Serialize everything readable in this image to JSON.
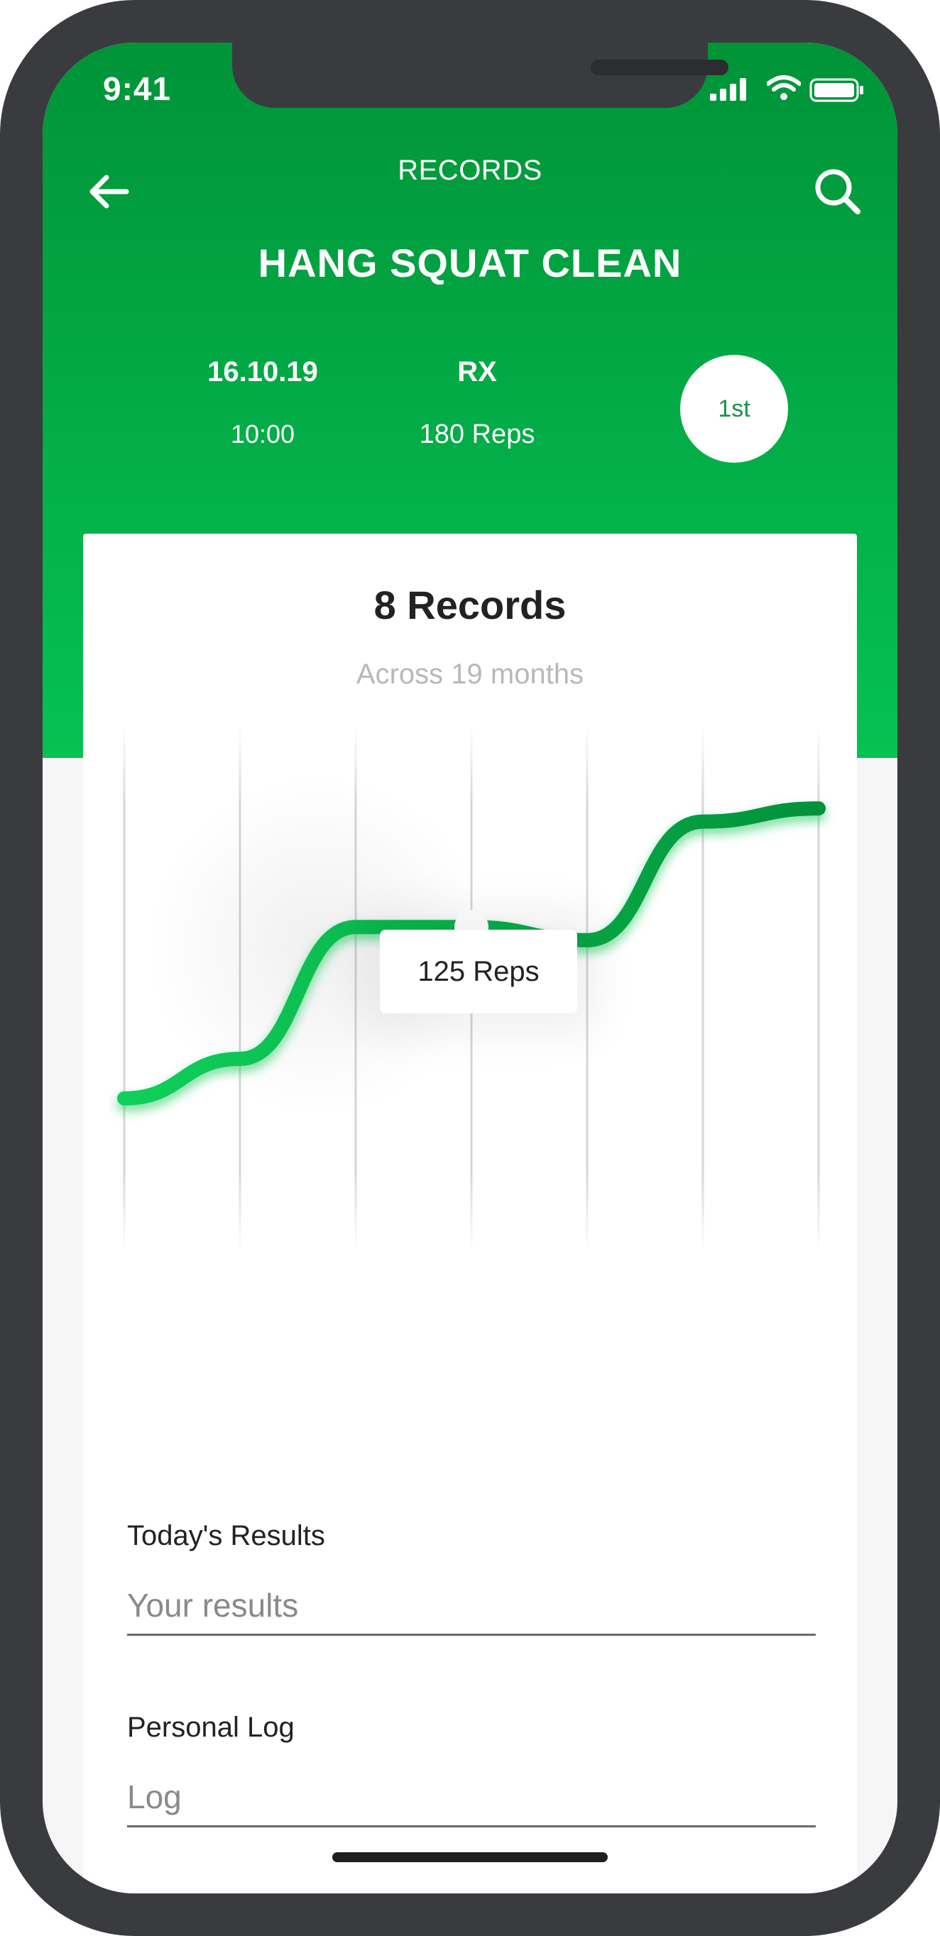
{
  "status_bar": {
    "time": "9:41"
  },
  "header": {
    "title": "RECORDS",
    "back_icon": "arrow-left-icon",
    "search_icon": "search-icon"
  },
  "exercise": {
    "name": "HANG SQUAT CLEAN",
    "date": "16.10.19",
    "time": "10:00",
    "level": "RX",
    "result": "180 Reps",
    "rank": "1st"
  },
  "records": {
    "count_label": "8 Records",
    "span_label": "Across 19 months",
    "tooltip": "125 Reps"
  },
  "chart_data": {
    "type": "line",
    "series": [
      {
        "values": [
          60,
          75,
          125,
          125,
          120,
          165,
          170
        ]
      }
    ],
    "highlighted_value": 125,
    "grid": "vertical"
  },
  "form": {
    "results_label": "Today's Results",
    "results_placeholder": "Your results",
    "log_label": "Personal Log",
    "log_placeholder": "Log"
  },
  "colors": {
    "brand_green_dark": "#009338",
    "brand_green_light": "#05c253",
    "line_green": "#06a342"
  }
}
